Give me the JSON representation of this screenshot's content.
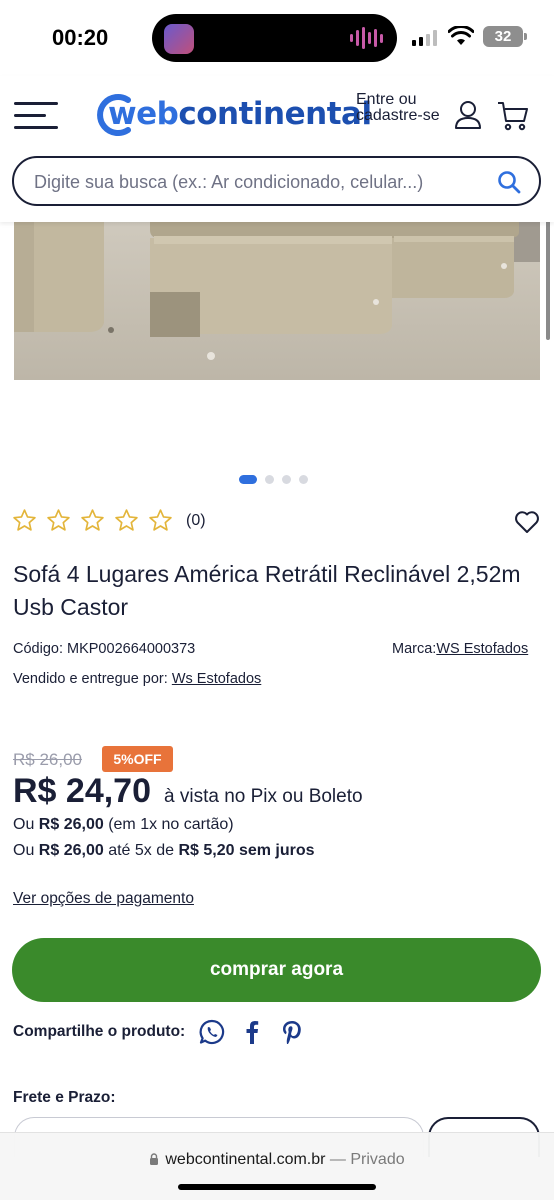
{
  "status_bar": {
    "time": "00:20",
    "battery": "32"
  },
  "header": {
    "logo_part1": "web",
    "logo_part2": "continental",
    "login_text": "Entre ou cadastre-se",
    "search_placeholder": "Digite sua busca (ex.: Ar condicionado, celular...)"
  },
  "carousel": {
    "total_slides": 4,
    "active_slide": 1
  },
  "product": {
    "rating_count": "(0)",
    "title": "Sofá 4 Lugares América Retrátil Reclinável 2,52m Usb Castor",
    "code_label": "Código:",
    "code_value": "MKP002664000373",
    "brand_label": "Marca:",
    "brand_value": "WS Estofados",
    "seller_label": "Vendido e entregue por:",
    "seller_value": "Ws Estofados"
  },
  "pricing": {
    "old_price": "R$ 26,00",
    "discount_badge": "5%OFF",
    "price": "R$ 24,70",
    "price_note": "à vista no Pix ou Boleto",
    "line1_prefix": "Ou",
    "line1_amount": "R$ 26,00",
    "line1_suffix": "(em 1x no cartão)",
    "line2_prefix": "Ou",
    "line2_amount": "R$ 26,00",
    "line2_middle": "até 5x de",
    "line2_installment": "R$ 5,20 sem juros",
    "payment_options_link": "Ver opções de pagamento"
  },
  "actions": {
    "buy_label": "comprar agora",
    "share_label": "Compartilhe o produto:",
    "shipping_label": "Frete e Prazo:"
  },
  "browser": {
    "domain": "webcontinental.com.br",
    "mode": "— Privado"
  },
  "colors": {
    "brand_blue": "#2f6fde",
    "buy_green": "#3a8a2b",
    "discount_orange": "#e8733a",
    "star_gold": "#e3b53a"
  }
}
